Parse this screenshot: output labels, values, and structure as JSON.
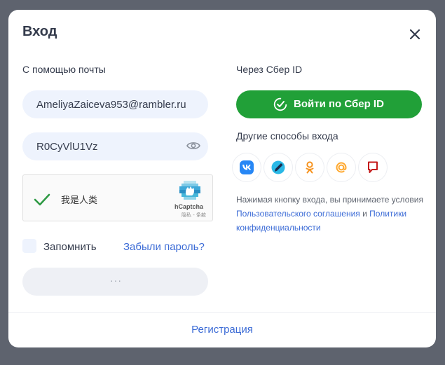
{
  "modal": {
    "title": "Вход",
    "close_icon": "close-icon"
  },
  "email_login": {
    "section_label": "С помощью почты",
    "email_value": "AmeliyaZaiceva953@rambler.ru",
    "password_value": "R0CyVlU1Vz",
    "show_password_icon": "eye-icon",
    "captcha": {
      "label": "我是人类",
      "brand": "hCaptcha",
      "legal": "隐私 - 条款",
      "state": "checked"
    },
    "remember_label": "Запомнить",
    "forgot_label": "Забыли пароль?",
    "submit_loading": "···"
  },
  "sber": {
    "section_label": "Через Сбер ID",
    "button_label": "Войти по Сбер ID",
    "button_color": "#21a038"
  },
  "other_methods": {
    "label": "Другие способы входа",
    "providers": [
      "vk-icon",
      "blue-pen-icon",
      "odnoklassniki-icon",
      "mail-at-icon",
      "red-flag-icon"
    ]
  },
  "terms": {
    "prefix": "Нажимая кнопку входа, вы принимаете условия ",
    "agreement_link": "Пользовательского соглашения",
    "and": " и ",
    "privacy_link": "Политики конфиденциальности"
  },
  "footer": {
    "register_label": "Регистрация"
  },
  "colors": {
    "accent_link": "#3b6bd6",
    "input_bg": "#eef3fd",
    "backdrop": "#5e636e"
  }
}
